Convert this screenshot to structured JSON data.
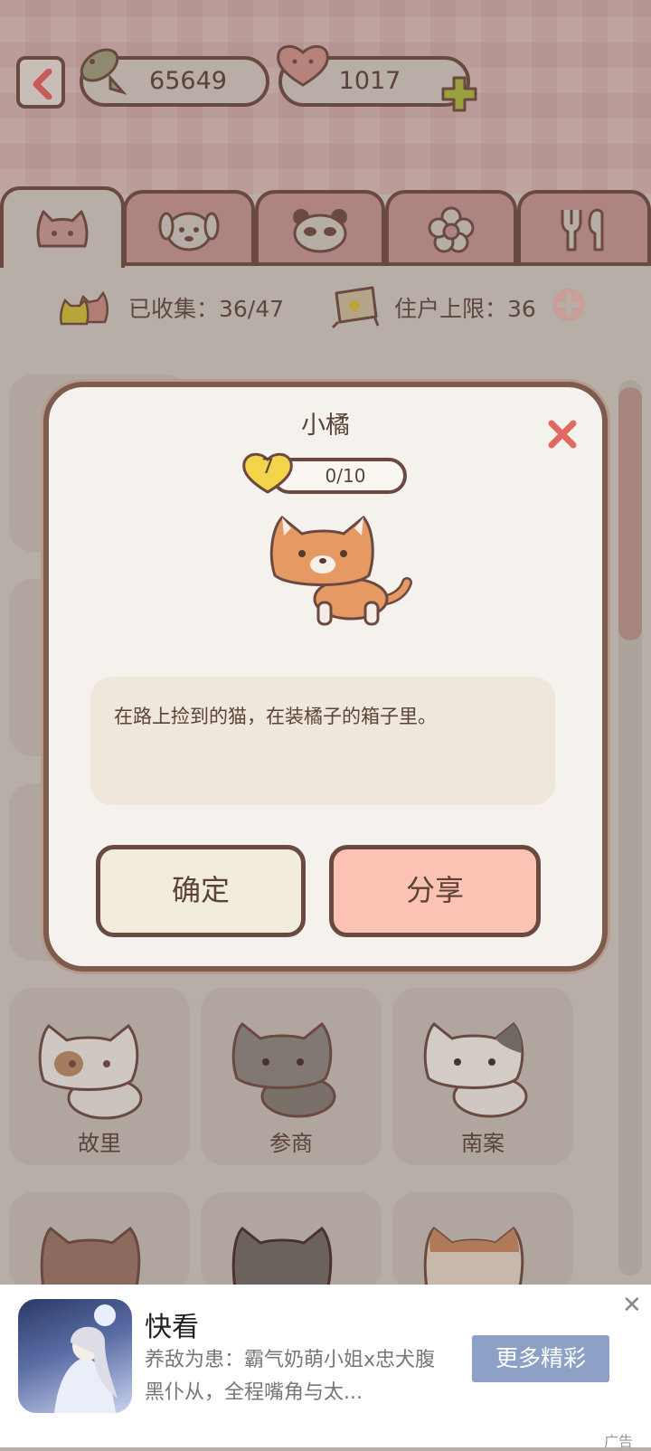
{
  "header": {
    "fish_count": "65649",
    "heart_count": "1017"
  },
  "tabs": [
    {
      "icon": "cat-face-icon",
      "active": true
    },
    {
      "icon": "dog-face-icon",
      "active": false
    },
    {
      "icon": "panda-face-icon",
      "active": false
    },
    {
      "icon": "flower-icon",
      "active": false
    },
    {
      "icon": "fork-knife-icon",
      "active": false
    }
  ],
  "stats": {
    "collected": "已收集：36/47",
    "resident_limit": "住户上限：36"
  },
  "modal": {
    "title": "小橘",
    "level": "7",
    "progress": "0/10",
    "description": "在路上捡到的猫，在装橘子的箱子里。",
    "confirm_label": "确定",
    "share_label": "分享"
  },
  "grid_names": [
    "故里",
    "参商",
    "南案"
  ],
  "ad": {
    "title": "快看",
    "description": "养敌为患：霸气奶萌小姐x忠犬腹黑仆从，全程嘴角与太...",
    "button": "更多精彩",
    "tag": "广告"
  },
  "colors": {
    "modal_bg": "#f5f1ec",
    "share_button": "#fcc3b4",
    "outline": "#6a4a40"
  }
}
